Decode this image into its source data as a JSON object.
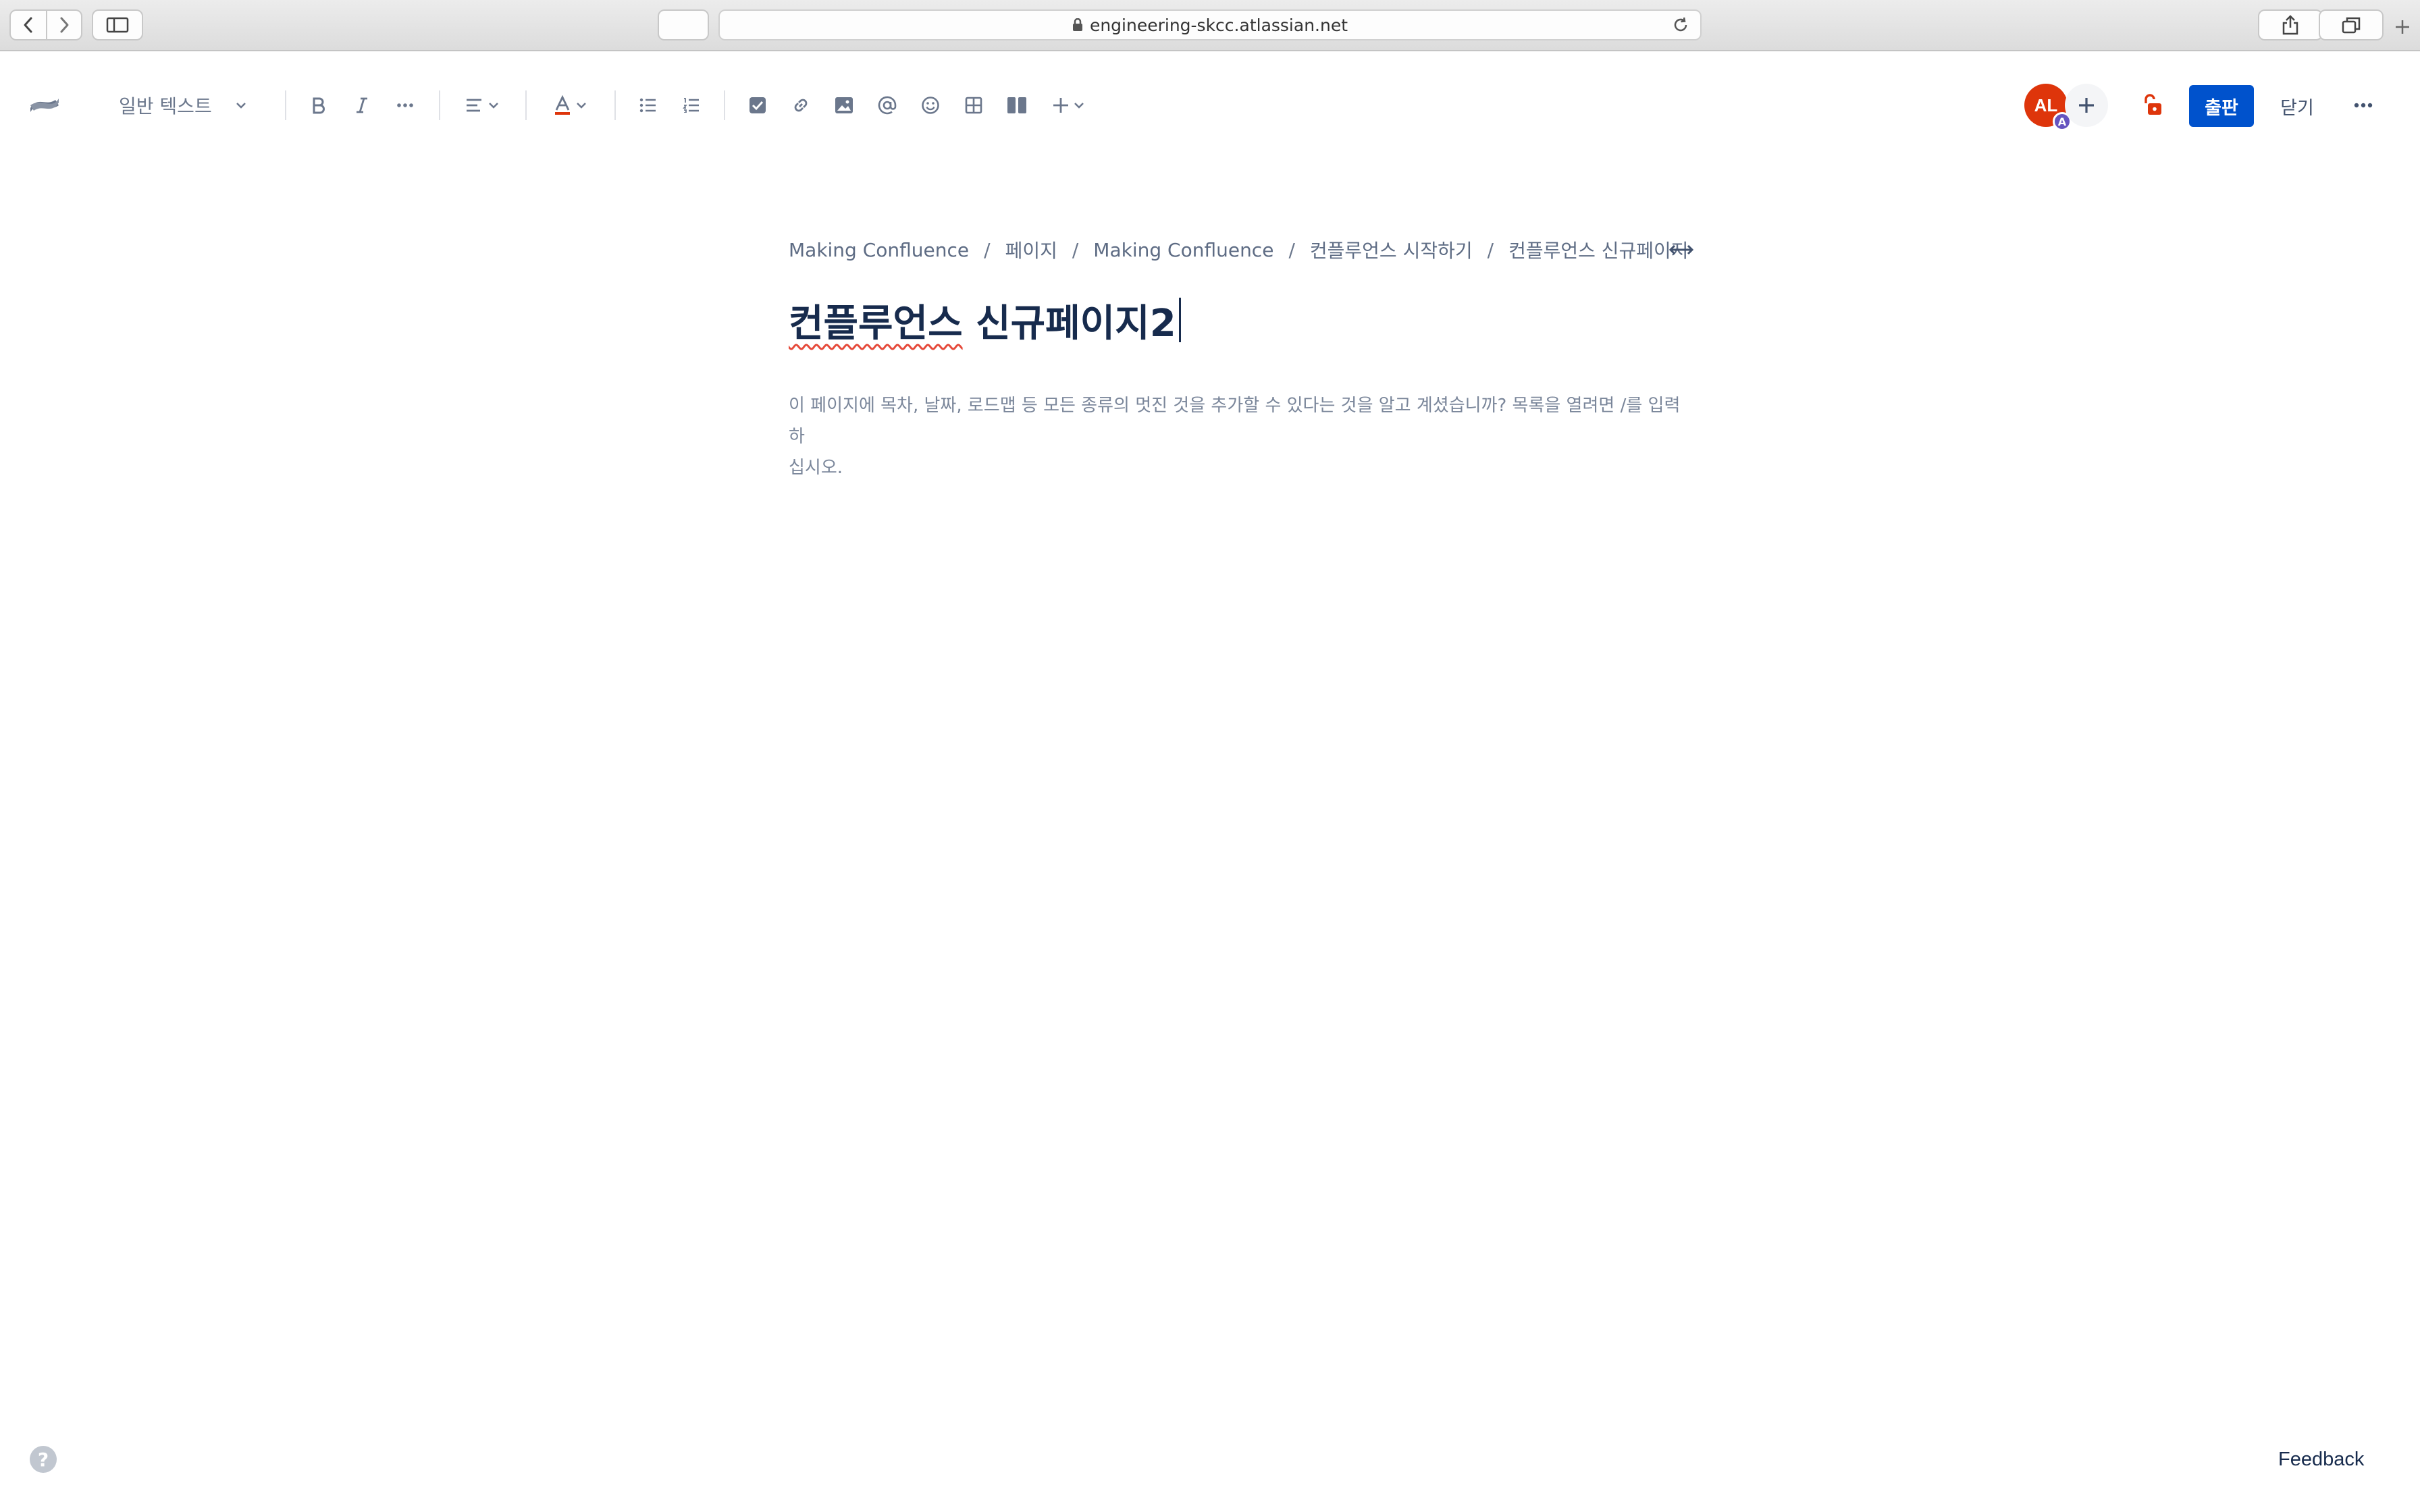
{
  "browser": {
    "url": "engineering-skcc.atlassian.net"
  },
  "toolbar": {
    "text_style_label": "일반 텍스트",
    "avatar_initials": "AL",
    "avatar_badge": "A",
    "publish_label": "출판",
    "close_label": "닫기"
  },
  "page": {
    "breadcrumb": [
      "Making Confluence",
      "페이지",
      "Making Confluence",
      "컨플루언스 시작하기",
      "컨플루언스 신규페이지"
    ],
    "title_misspelled": "컨플루언스",
    "title_rest": " 신규페이지2",
    "placeholder_line1": "이 페이지에 목차, 날짜, 로드맵 등 모든 종류의 멋진 것을 추가할 수 있다는 것을 알고 계셨습니까? 목록을 열려면 /를 입력하",
    "placeholder_line2": "십시오."
  },
  "footer": {
    "help_label": "?",
    "feedback_label": "Feedback"
  },
  "colors": {
    "publish": "#0052cc",
    "avatar": "#de350b",
    "badge": "#6554c0",
    "restriction": "#de350b"
  }
}
